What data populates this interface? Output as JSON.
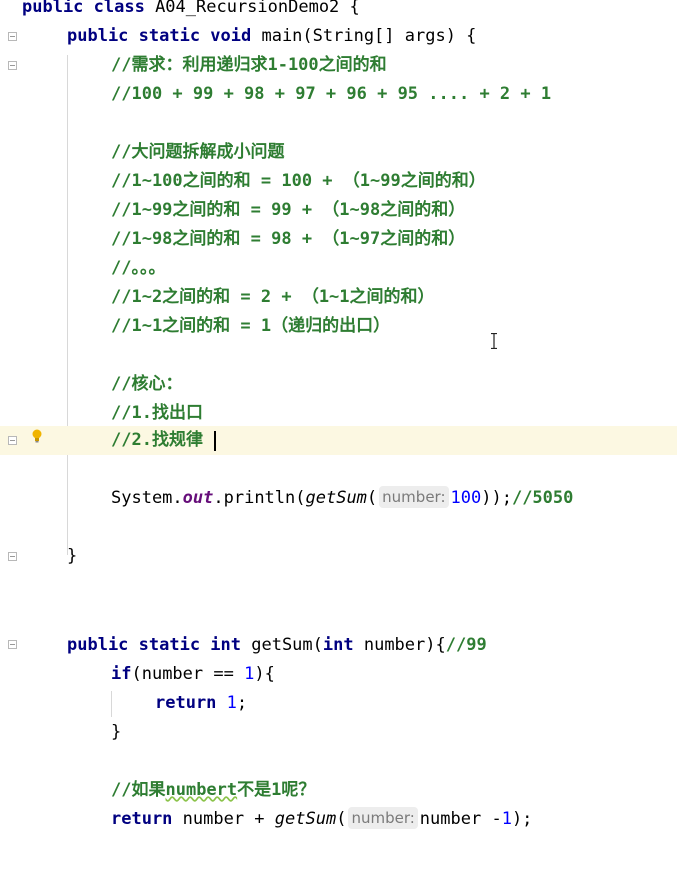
{
  "code": {
    "l1": [
      "public class ",
      "A04_RecursionDemo2",
      " {"
    ],
    "l2": [
      "public static void ",
      "main(String[] args) {"
    ],
    "l3": "//需求：利用递归求1-100之间的和",
    "l4": "//100 + 99 + 98 + 97 + 96 + 95 .... + 2 + 1",
    "l6": "//大问题拆解成小问题",
    "l7": "//1~100之间的和 = 100 + （1~99之间的和）",
    "l8": "//1~99之间的和 = 99 + （1~98之间的和）",
    "l9": "//1~98之间的和 = 98 + （1~97之间的和）",
    "l10": "//。。。",
    "l11": "//1~2之间的和 = 2 + （1~1之间的和）",
    "l12": "//1~1之间的和 = 1（递归的出口）",
    "l14": "//核心：",
    "l15": "//1.找出口",
    "l16": "//2.找规律",
    "l18": [
      "System.",
      "out",
      ".println(",
      "getSum",
      "(",
      "number:",
      "100",
      "));",
      "//5050"
    ],
    "l20": "}",
    "l23": [
      "public static int ",
      "getSum(",
      "int ",
      "number){",
      "//99"
    ],
    "l24": [
      "if",
      "(number == ",
      "1",
      "){"
    ],
    "l25": [
      "return ",
      "1",
      ";"
    ],
    "l26": "}",
    "l28": [
      "//如果",
      "numbert",
      "不是1呢？"
    ],
    "l29": [
      "return ",
      "number + ",
      "getSum",
      "(",
      "number:",
      "number -",
      "1",
      ");"
    ]
  },
  "colors": {
    "keyword": "#000080",
    "comment": "#2e7d32",
    "number": "#0000ff",
    "field": "#660e7a",
    "current_line": "#fcf8e2",
    "hint_bg": "#ededed"
  },
  "icons": [
    "fold-marker-icon",
    "lightbulb-icon",
    "text-cursor-icon"
  ]
}
